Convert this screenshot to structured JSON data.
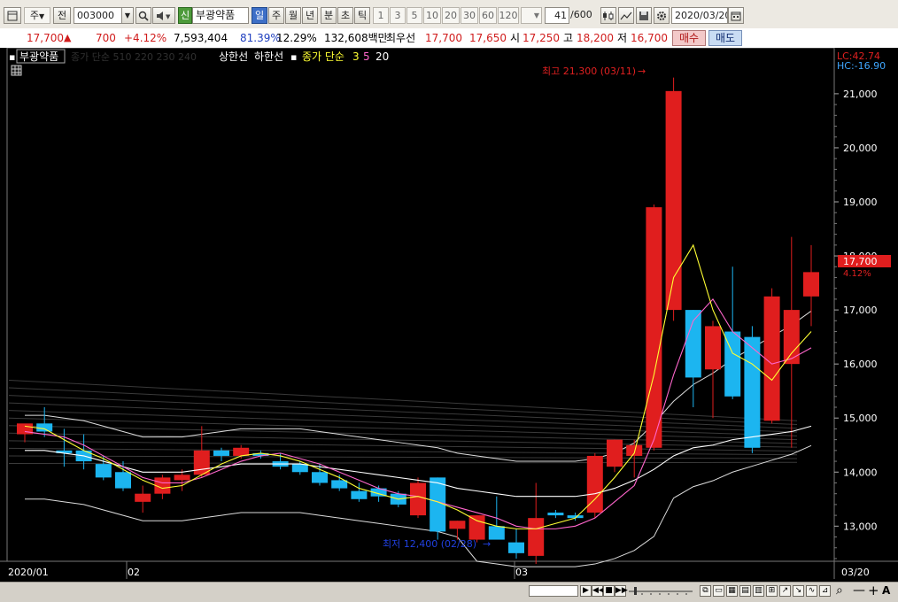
{
  "toolbar": {
    "period_unit": "주",
    "prev_label": "전",
    "code_value": "003000",
    "stock_badge": "신",
    "stock_name": "부광약품",
    "periods": [
      "일",
      "주",
      "월",
      "년"
    ],
    "active_period": "일",
    "intraday": [
      "분",
      "초",
      "틱"
    ],
    "intervals": [
      "1",
      "3",
      "5",
      "10",
      "20",
      "30",
      "60",
      "120"
    ],
    "count_value": "41",
    "count_max": "/600",
    "date_value": "2020/03/20"
  },
  "quote": {
    "price": "17,700",
    "change": "700",
    "change_pct": "+4.12%",
    "volume": "7,593,404",
    "vol_ratio": "81.39%",
    "turnover": "12.29%",
    "amount": "132,608백만",
    "best_label": "최우선",
    "best_ask": "17,700",
    "best_bid": "17,650",
    "open_label": "시",
    "open": "17,250",
    "high_label": "고",
    "high": "18,200",
    "low_label": "저",
    "low": "16,700",
    "buy_label": "매수",
    "sell_label": "매도"
  },
  "legend": {
    "stock_name": "부광약품",
    "ma_label": "종가 단순 510 220 230 240",
    "limit_up": "상한선",
    "limit_down": "하한선",
    "ma2_label": "종가 단순",
    "ma2_periods": [
      "3",
      "5",
      "20"
    ]
  },
  "colors": {
    "up": "#e01e1e",
    "down": "#1cb5f0",
    "ma3": "#ffff33",
    "ma5": "#ff66cc",
    "ma20": "#ffffff"
  },
  "annotations": {
    "max_text": "최고 21,300 (03/11)",
    "min_text": "최저 12,400 (02/28)",
    "lc": "LC:42.74",
    "hc": "HC:-16.90"
  },
  "current_tag": {
    "price": "17,700",
    "pct": "4.12%"
  },
  "x_labels": [
    "2020/01",
    "02",
    "03",
    "03/20"
  ],
  "chart_data": {
    "type": "candlestick",
    "y_ticks": [
      13000,
      14000,
      15000,
      16000,
      17000,
      18000,
      19000,
      20000,
      21000
    ],
    "ylim": [
      12350,
      21850
    ],
    "candles": [
      {
        "o": 14700,
        "h": 14850,
        "l": 14550,
        "c": 14900
      },
      {
        "o": 14900,
        "h": 15200,
        "l": 14650,
        "c": 14750
      },
      {
        "o": 14400,
        "h": 14800,
        "l": 14100,
        "c": 14350
      },
      {
        "o": 14400,
        "h": 14700,
        "l": 14050,
        "c": 14200
      },
      {
        "o": 14150,
        "h": 14300,
        "l": 13850,
        "c": 13900
      },
      {
        "o": 14000,
        "h": 14200,
        "l": 13650,
        "c": 13700
      },
      {
        "o": 13450,
        "h": 13750,
        "l": 13250,
        "c": 13600
      },
      {
        "o": 13600,
        "h": 13950,
        "l": 13500,
        "c": 13900
      },
      {
        "o": 13850,
        "h": 14050,
        "l": 13650,
        "c": 13950
      },
      {
        "o": 13950,
        "h": 14850,
        "l": 13900,
        "c": 14400
      },
      {
        "o": 14400,
        "h": 14450,
        "l": 14200,
        "c": 14300
      },
      {
        "o": 14300,
        "h": 14500,
        "l": 14250,
        "c": 14450
      },
      {
        "o": 14350,
        "h": 14400,
        "l": 14250,
        "c": 14300
      },
      {
        "o": 14200,
        "h": 14350,
        "l": 14050,
        "c": 14100
      },
      {
        "o": 14150,
        "h": 14200,
        "l": 13950,
        "c": 14000
      },
      {
        "o": 14000,
        "h": 14150,
        "l": 13750,
        "c": 13800
      },
      {
        "o": 13850,
        "h": 13950,
        "l": 13650,
        "c": 13700
      },
      {
        "o": 13650,
        "h": 13800,
        "l": 13450,
        "c": 13500
      },
      {
        "o": 13700,
        "h": 13750,
        "l": 13450,
        "c": 13550
      },
      {
        "o": 13600,
        "h": 13650,
        "l": 13350,
        "c": 13400
      },
      {
        "o": 13200,
        "h": 13900,
        "l": 13150,
        "c": 13800
      },
      {
        "o": 13900,
        "h": 13900,
        "l": 12750,
        "c": 12900
      },
      {
        "o": 12950,
        "h": 13100,
        "l": 12750,
        "c": 13100
      },
      {
        "o": 12750,
        "h": 13200,
        "l": 12700,
        "c": 13200
      },
      {
        "o": 13000,
        "h": 13550,
        "l": 12850,
        "c": 12750
      },
      {
        "o": 12700,
        "h": 12950,
        "l": 12400,
        "c": 12500
      },
      {
        "o": 12450,
        "h": 13800,
        "l": 12300,
        "c": 13150
      },
      {
        "o": 13250,
        "h": 13300,
        "l": 13150,
        "c": 13200
      },
      {
        "o": 13200,
        "h": 13250,
        "l": 13100,
        "c": 13150
      },
      {
        "o": 13250,
        "h": 14350,
        "l": 13150,
        "c": 14300
      },
      {
        "o": 14100,
        "h": 14600,
        "l": 14000,
        "c": 14600
      },
      {
        "o": 14300,
        "h": 14600,
        "l": 13900,
        "c": 14500
      },
      {
        "o": 14450,
        "h": 18950,
        "l": 14400,
        "c": 18900
      },
      {
        "o": 17000,
        "h": 21300,
        "l": 16800,
        "c": 21050
      },
      {
        "o": 17000,
        "h": 17000,
        "l": 15200,
        "c": 15750
      },
      {
        "o": 15900,
        "h": 16800,
        "l": 15000,
        "c": 16700
      },
      {
        "o": 16600,
        "h": 17800,
        "l": 15350,
        "c": 15400
      },
      {
        "o": 16500,
        "h": 16700,
        "l": 14350,
        "c": 14450
      },
      {
        "o": 14950,
        "h": 17400,
        "l": 14900,
        "c": 17250
      },
      {
        "o": 16000,
        "h": 18350,
        "l": 14450,
        "c": 17000
      },
      {
        "o": 17250,
        "h": 18200,
        "l": 16700,
        "c": 17700
      }
    ],
    "ma3": [
      14850,
      14800,
      14600,
      14400,
      14250,
      14050,
      13850,
      13700,
      13750,
      13950,
      14150,
      14300,
      14350,
      14300,
      14200,
      14050,
      13900,
      13700,
      13600,
      13500,
      13550,
      13450,
      13300,
      13100,
      13000,
      12950,
      12950,
      13050,
      13150,
      13500,
      13900,
      14350,
      15800,
      17600,
      18200,
      17000,
      16200,
      16000,
      15700,
      16200,
      16600
    ],
    "ma5": [
      14750,
      14700,
      14650,
      14500,
      14300,
      14100,
      13900,
      13800,
      13800,
      13900,
      14050,
      14200,
      14300,
      14350,
      14250,
      14150,
      14000,
      13850,
      13700,
      13600,
      13550,
      13450,
      13350,
      13250,
      13150,
      13000,
      12950,
      12950,
      13000,
      13150,
      13450,
      13750,
      14600,
      15800,
      16800,
      17200,
      16600,
      16300,
      16000,
      16100,
      16300
    ],
    "ma20": [
      14400,
      14400,
      14350,
      14300,
      14200,
      14100,
      14000,
      14000,
      14000,
      14050,
      14100,
      14150,
      14150,
      14150,
      14150,
      14100,
      14050,
      14000,
      13950,
      13900,
      13850,
      13800,
      13700,
      13650,
      13600,
      13550,
      13550,
      13550,
      13550,
      13600,
      13700,
      13850,
      14050,
      14300,
      14450,
      14500,
      14600,
      14650,
      14700,
      14750,
      14850
    ]
  }
}
